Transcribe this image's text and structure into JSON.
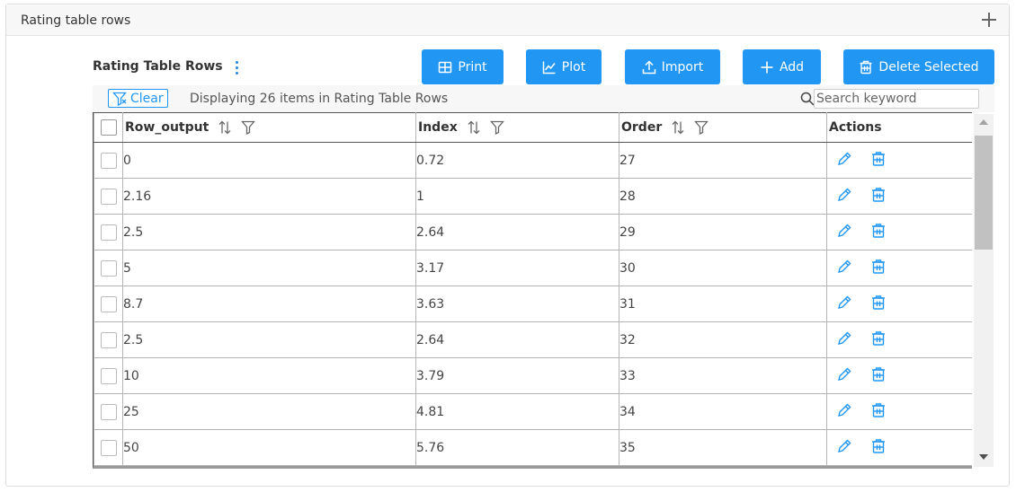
{
  "panel": {
    "title": "Rating table rows"
  },
  "section": {
    "title": "Rating Table Rows"
  },
  "buttons": {
    "print": "Print",
    "plot": "Plot",
    "import": "Import",
    "add": "Add",
    "delete_selected": "Delete Selected"
  },
  "toolbar": {
    "clear": "Clear",
    "display": "Displaying 26 items in Rating Table Rows",
    "search_placeholder": "Search keyword"
  },
  "table": {
    "columns": [
      "Row_output",
      "Index",
      "Order",
      "Actions"
    ],
    "rows": [
      [
        "0",
        "0.72",
        "27"
      ],
      [
        "2.16",
        "1",
        "28"
      ],
      [
        "2.5",
        "2.64",
        "29"
      ],
      [
        "5",
        "3.17",
        "30"
      ],
      [
        "8.7",
        "3.63",
        "31"
      ],
      [
        "2.5",
        "2.64",
        "32"
      ],
      [
        "10",
        "3.79",
        "33"
      ],
      [
        "25",
        "4.81",
        "34"
      ],
      [
        "50",
        "5.76",
        "35"
      ]
    ]
  },
  "icons": {
    "edit": "pencil-icon",
    "delete": "trash-icon",
    "sort": "sort-icon",
    "filter": "filter-icon"
  },
  "colors": {
    "accent": "#2196f3",
    "header_bg": "#f7f7f7"
  }
}
